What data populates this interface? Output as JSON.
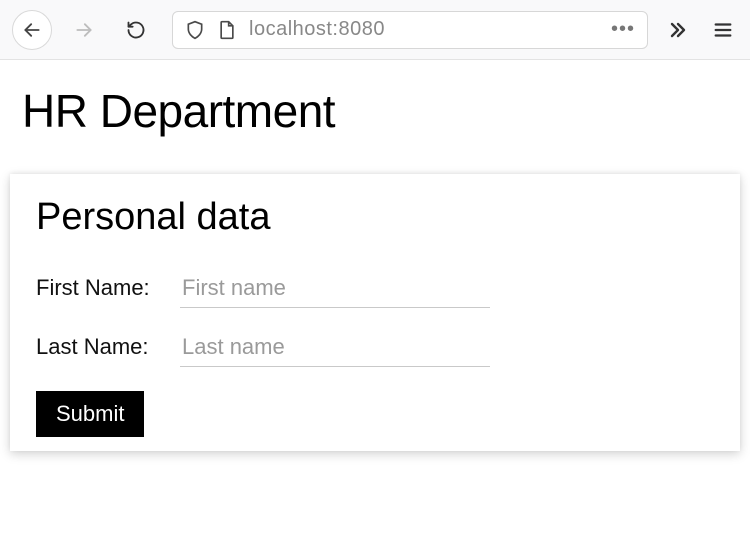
{
  "browser": {
    "url": "localhost:8080"
  },
  "page": {
    "title": "HR Department"
  },
  "card": {
    "title": "Personal data",
    "fields": {
      "first_name": {
        "label": "First Name:",
        "placeholder": "First name",
        "value": ""
      },
      "last_name": {
        "label": "Last Name:",
        "placeholder": "Last name",
        "value": ""
      }
    },
    "submit_label": "Submit"
  }
}
